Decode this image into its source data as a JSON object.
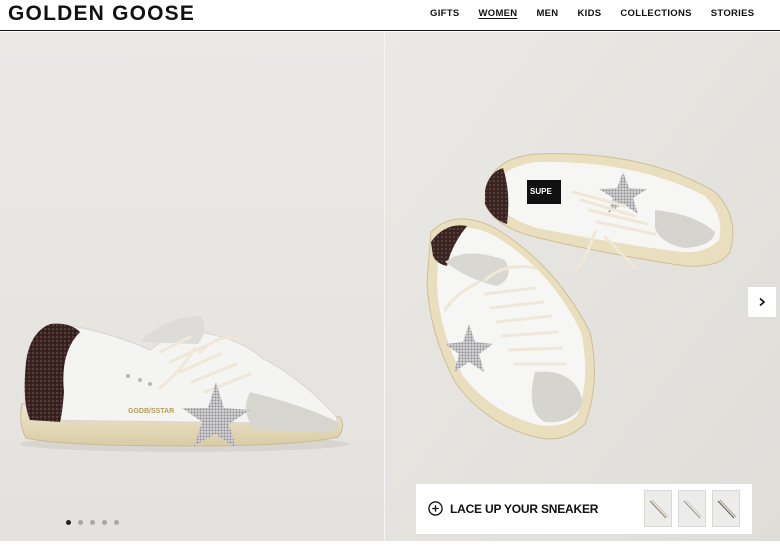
{
  "header": {
    "logo": "GOLDEN GOOSE",
    "nav": [
      {
        "label": "GIFTS",
        "active": false
      },
      {
        "label": "WOMEN",
        "active": true
      },
      {
        "label": "MEN",
        "active": false
      },
      {
        "label": "KIDS",
        "active": false
      },
      {
        "label": "COLLECTIONS",
        "active": false
      },
      {
        "label": "STORIES",
        "active": false
      }
    ]
  },
  "gallery": {
    "left_shoe_text": "GGDB/SSTAR",
    "right_shoe_tag": "SUPE",
    "dots": {
      "count": 5,
      "active_index": 0
    }
  },
  "lace_card": {
    "label": "LACE UP YOUR SNEAKER",
    "thumbnails": [
      "lace-thumbnail-1",
      "lace-thumbnail-2",
      "lace-thumbnail-3"
    ]
  },
  "colors": {
    "left_bg": "#e8e6e3",
    "right_bg": "#e6e4e0",
    "glitter": "#3a2422",
    "star": "#b9b9bc"
  }
}
